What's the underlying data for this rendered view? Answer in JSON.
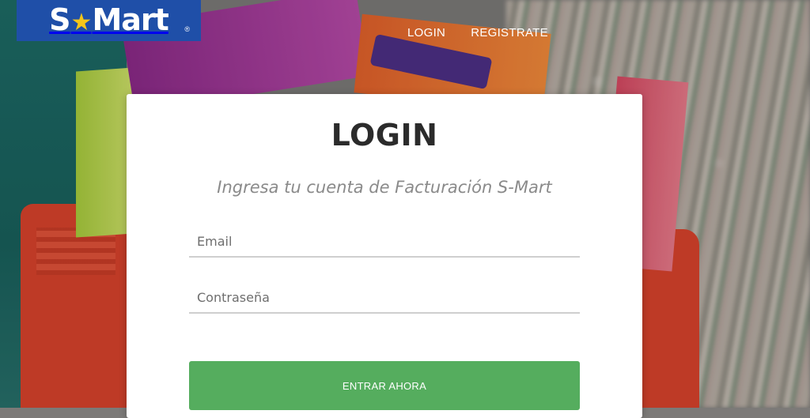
{
  "brand": {
    "logo_prefix": "S",
    "logo_suffix": "Mart",
    "registered_mark": "®",
    "colors": {
      "logo_background": "#1f4fa8",
      "star": "#f5c518",
      "button": "#55ad5e"
    }
  },
  "nav": {
    "login_label": "LOGIN",
    "register_label": "REGISTRATE"
  },
  "login_card": {
    "title": "LOGIN",
    "subtitle": "Ingresa tu cuenta de Facturación S-Mart",
    "email_placeholder": "Email",
    "password_placeholder": "Contraseña",
    "submit_label": "ENTRAR AHORA"
  }
}
